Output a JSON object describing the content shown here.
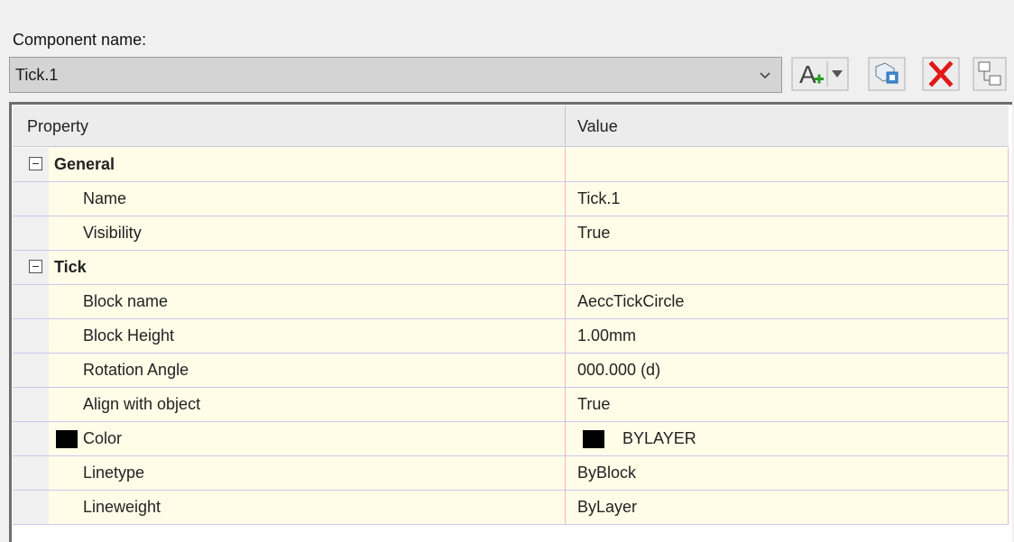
{
  "component": {
    "label": "Component name:",
    "selected": "Tick.1"
  },
  "toolbar": {
    "add_icon": "add-component-icon",
    "copy_icon": "copy-component-icon",
    "delete_icon": "delete-icon",
    "order_icon": "draw-order-icon"
  },
  "grid": {
    "header_property": "Property",
    "header_value": "Value",
    "categories": [
      {
        "name": "General",
        "rows": [
          {
            "property": "Name",
            "value": "Tick.1"
          },
          {
            "property": "Visibility",
            "value": "True"
          }
        ]
      },
      {
        "name": "Tick",
        "rows": [
          {
            "property": "Block name",
            "value": "AeccTickCircle"
          },
          {
            "property": "Block Height",
            "value": "1.00mm"
          },
          {
            "property": "Rotation Angle",
            "value": "000.000 (d)"
          },
          {
            "property": "Align with object",
            "value": "True"
          },
          {
            "property": "Color",
            "value": "BYLAYER",
            "swatch": "#000000"
          },
          {
            "property": "Linetype",
            "value": "ByBlock"
          },
          {
            "property": "Lineweight",
            "value": "ByLayer"
          }
        ]
      }
    ]
  }
}
